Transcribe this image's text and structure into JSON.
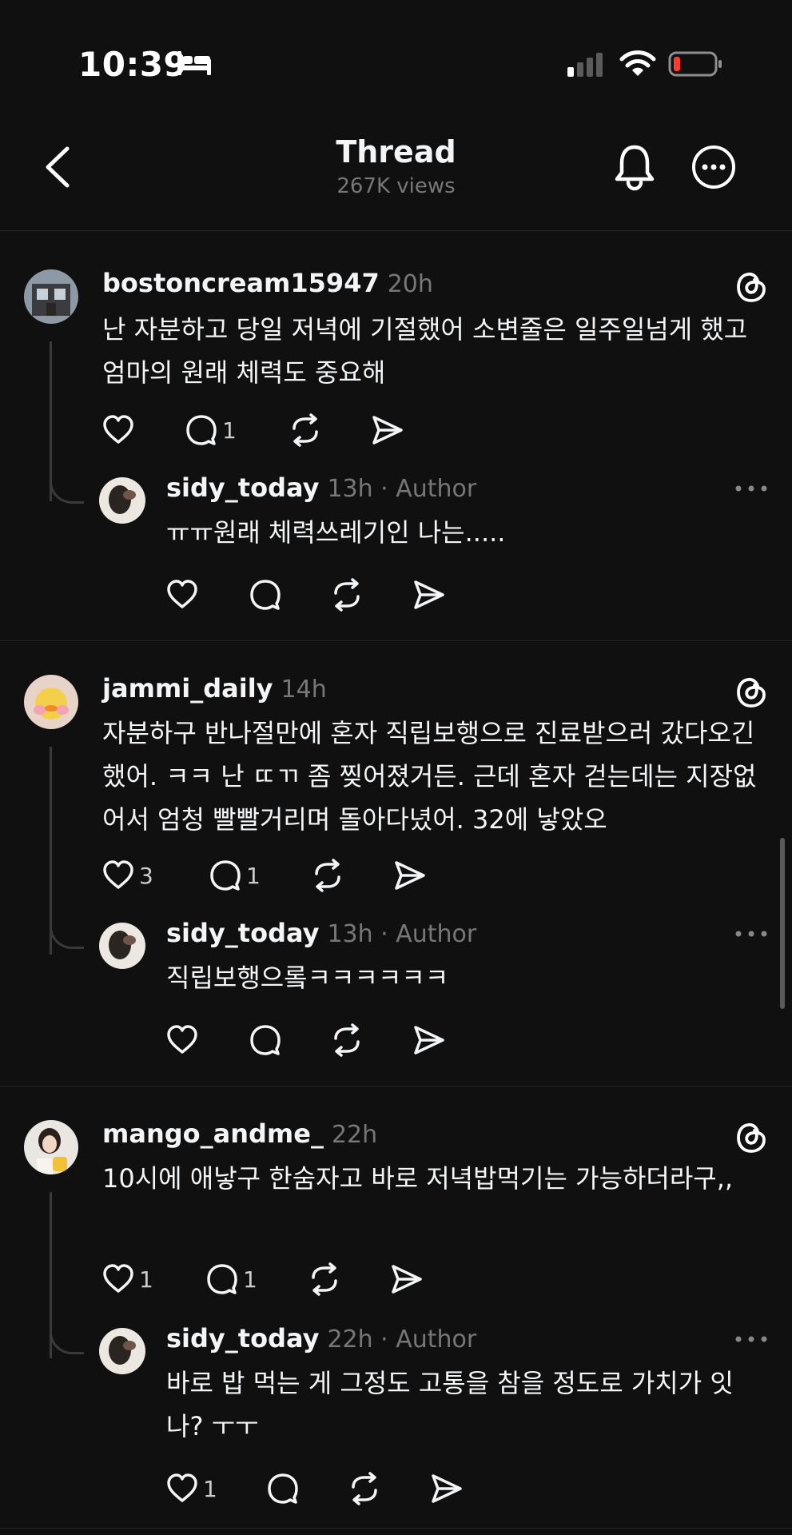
{
  "status_bar": {
    "time": "10:39"
  },
  "header": {
    "title": "Thread",
    "subtitle": "267K views"
  },
  "comments": [
    {
      "username": "bostoncream15947",
      "time": "20h",
      "text": "난 자분하고 당일 저녁에 기절했어 소변줄은 일주일넘게 했고 엄마의 원래 체력도 중요해",
      "likes": "",
      "replies": "1",
      "reply": {
        "username": "sidy_today",
        "meta": "13h · Author",
        "text": "ㅠㅠ원래 체력쓰레기인 나는.....",
        "likes": "",
        "replies": ""
      }
    },
    {
      "username": "jammi_daily",
      "time": "14h",
      "text": "자분하구 반나절만에 혼자 직립보행으로 진료받으러 갔다오긴했어. ㅋㅋ 난 ㄸㄲ 좀 찢어졌거든. 근데 혼자 걷는데는 지장없어서 엄청 빨빨거리며 돌아다녔어. 32에 낳았오",
      "likes": "3",
      "replies": "1",
      "reply": {
        "username": "sidy_today",
        "meta": "13h · Author",
        "text": "직립보행으롴ㅋㅋㅋㅋㅋㅋ",
        "likes": "",
        "replies": ""
      }
    },
    {
      "username": "mango_andme_",
      "time": "22h",
      "text": "10시에 애낳구 한숨자고 바로 저녁밥먹기는 가능하더라구,,",
      "likes": "1",
      "replies": "1",
      "reply": {
        "username": "sidy_today",
        "meta": "22h · Author",
        "text": "바로 밥 먹는 게 그정도 고통을 참을 정도로 가치가 잇나? ㅜㅜ",
        "likes": "1",
        "replies": ""
      }
    }
  ]
}
